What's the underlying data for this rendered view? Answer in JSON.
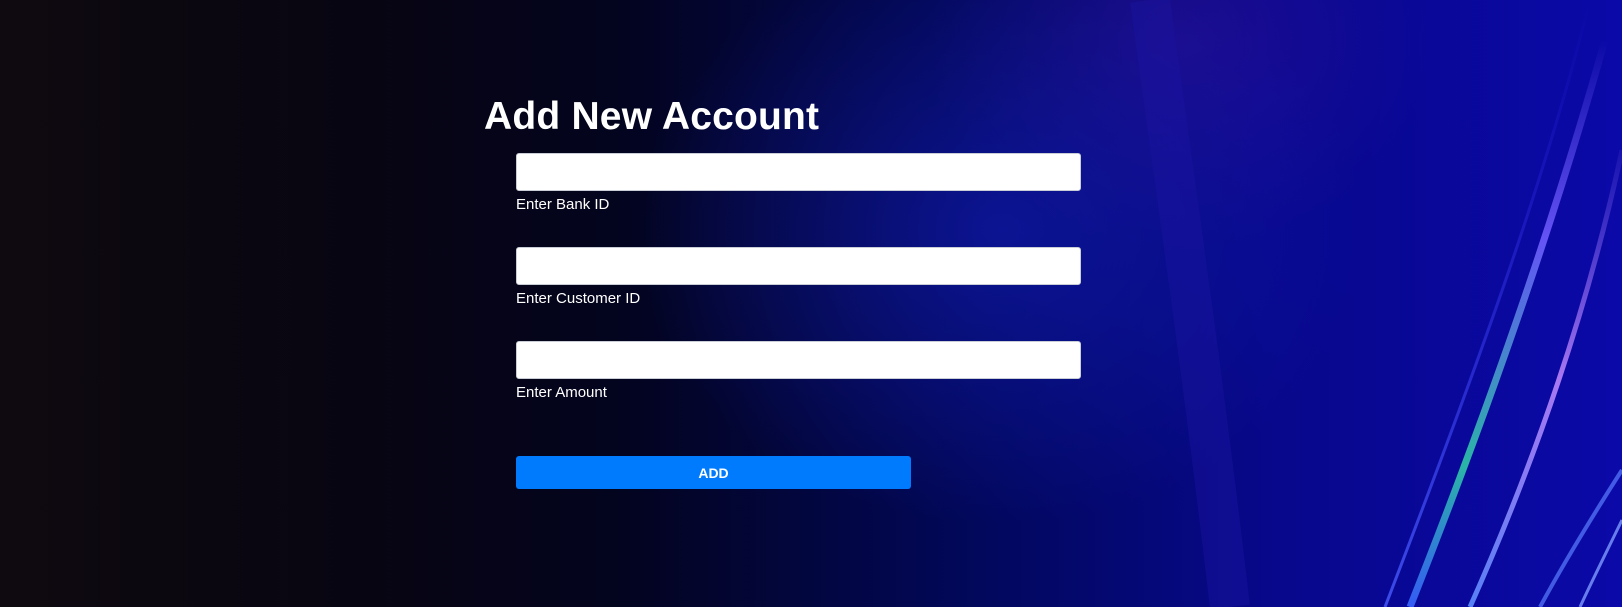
{
  "page": {
    "title": "Add New Account"
  },
  "form": {
    "fields": [
      {
        "label": "Enter Bank ID",
        "value": "",
        "placeholder": ""
      },
      {
        "label": "Enter Customer ID",
        "value": "",
        "placeholder": ""
      },
      {
        "label": "Enter Amount",
        "value": "",
        "placeholder": ""
      }
    ],
    "submit_label": "ADD"
  },
  "colors": {
    "button_background": "#017bfe",
    "text": "#ffffff",
    "background_dark": "#0f0a0f",
    "background_blue": "#0b09a8"
  }
}
